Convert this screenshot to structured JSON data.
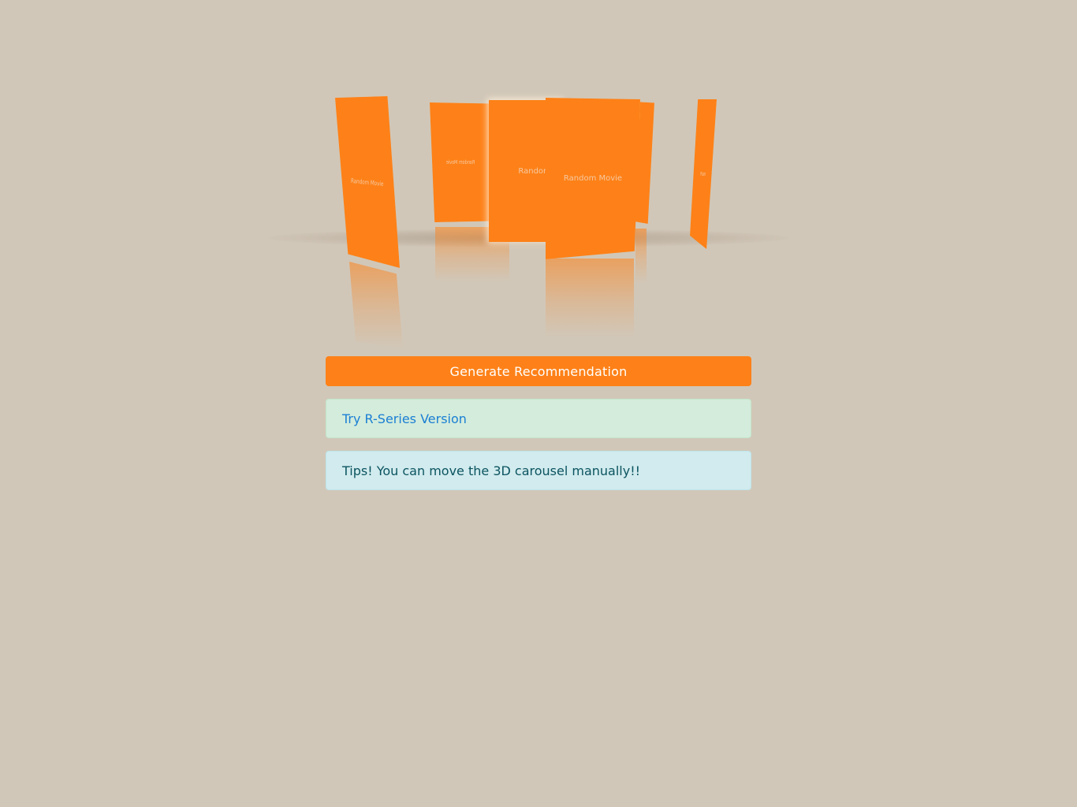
{
  "carousel": {
    "cards": [
      {
        "label": "Random Movie"
      },
      {
        "label": "Random Movie"
      },
      {
        "label": "Random M"
      },
      {
        "label": "Random Movie"
      },
      {
        "label": "Ran"
      }
    ],
    "card_color": "#fd8118"
  },
  "actions": {
    "generate_label": "Generate Recommendation"
  },
  "links": {
    "r_series_label": "Try R-Series Version"
  },
  "tips": {
    "text": "Tips! You can move the 3D carousel manually!!"
  },
  "colors": {
    "background": "#d1c7b8",
    "accent": "#fd8118",
    "success_bg": "#d4ecdb",
    "info_bg": "#d1ebee",
    "link": "#1a7fd4",
    "info_text": "#0c5460"
  }
}
